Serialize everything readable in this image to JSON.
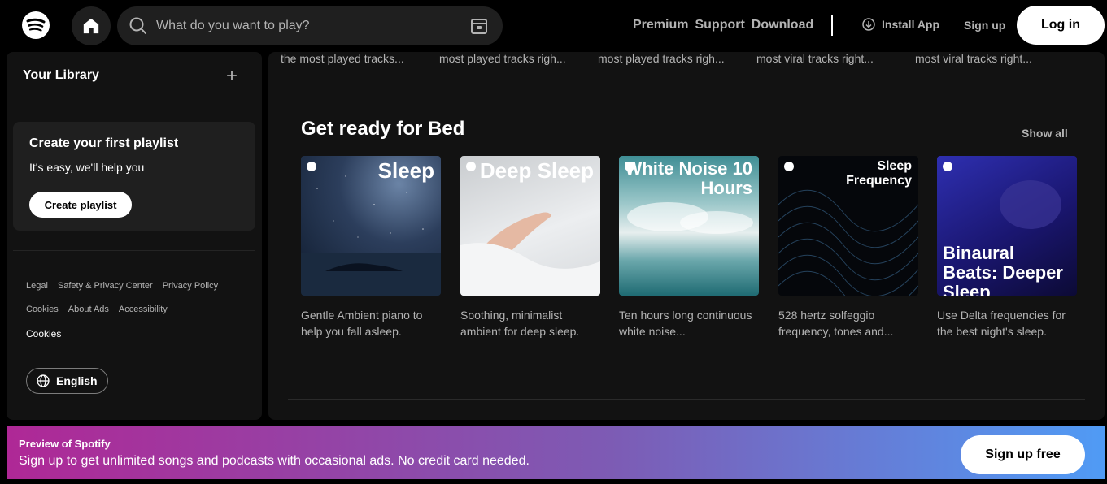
{
  "header": {
    "search_placeholder": "What do you want to play?",
    "nav": [
      "Premium",
      "Support",
      "Download"
    ],
    "install_app": "Install App",
    "sign_up": "Sign up",
    "log_in": "Log in"
  },
  "sidebar": {
    "title": "Your Library",
    "create_card": {
      "title": "Create your first playlist",
      "subtitle": "It's easy, we'll help you",
      "button": "Create playlist"
    },
    "footer_links": {
      "row1": [
        "Legal",
        "Safety & Privacy Center",
        "Privacy Policy"
      ],
      "row2": [
        "Cookies",
        "About Ads",
        "Accessibility"
      ],
      "row3": "Cookies"
    },
    "language": "English"
  },
  "main": {
    "top_captions": [
      "the most played tracks...",
      "most played tracks righ...",
      "most played tracks righ...",
      "most viral tracks right...",
      "most viral tracks right..."
    ],
    "section_title": "Get ready for Bed",
    "show_all": "Show all",
    "cards": [
      {
        "cover_text": "Sleep",
        "desc": "Gentle Ambient piano to help you fall asleep."
      },
      {
        "cover_text": "Deep Sleep",
        "desc": "Soothing, minimalist ambient for deep sleep."
      },
      {
        "cover_text": "White Noise 10 Hours",
        "desc": "Ten hours long continuous white noise..."
      },
      {
        "cover_text": "Sleep Frequency",
        "desc": "528 hertz solfeggio frequency, tones and..."
      },
      {
        "cover_text": "Binaural Beats: Deeper Sleep",
        "desc": "Use Delta frequencies for the best night's sleep."
      }
    ]
  },
  "banner": {
    "title": "Preview of Spotify",
    "text": "Sign up to get unlimited songs and podcasts with occasional ads. No credit card needed.",
    "button": "Sign up free"
  },
  "colors": {
    "background": "#000000",
    "surface": "#121212",
    "muted_text": "#b3b3b3",
    "banner_start": "#af2896",
    "banner_end": "#509bf5"
  }
}
